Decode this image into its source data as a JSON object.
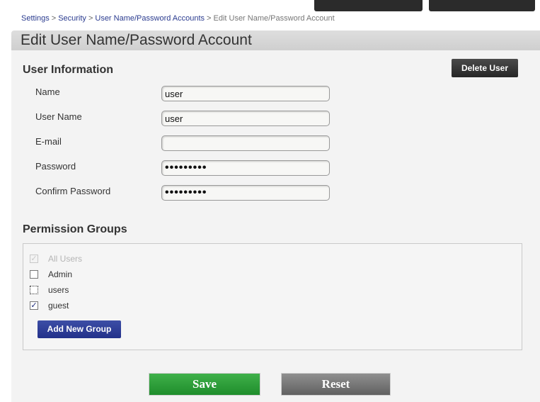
{
  "breadcrumb": {
    "items": [
      "Settings",
      "Security",
      "User Name/Password Accounts"
    ],
    "current": "Edit User Name/Password Account",
    "separator": ">"
  },
  "page_title": "Edit User Name/Password Account",
  "user_info": {
    "heading": "User Information",
    "delete_label": "Delete User",
    "fields": {
      "name": {
        "label": "Name",
        "value": "user"
      },
      "username": {
        "label": "User Name",
        "value": "user"
      },
      "email": {
        "label": "E-mail",
        "value": ""
      },
      "password": {
        "label": "Password",
        "value": "•••••••••"
      },
      "confirm": {
        "label": "Confirm Password",
        "value": "•••••••••"
      }
    }
  },
  "permissions": {
    "heading": "Permission Groups",
    "groups": [
      {
        "label": "All Users",
        "checked": true,
        "disabled": true
      },
      {
        "label": "Admin",
        "checked": false,
        "disabled": false
      },
      {
        "label": "users",
        "checked": false,
        "disabled": false
      },
      {
        "label": "guest",
        "checked": true,
        "disabled": false
      }
    ],
    "add_label": "Add New Group"
  },
  "actions": {
    "save_label": "Save",
    "reset_label": "Reset"
  },
  "colors": {
    "accent_blue": "#23318a",
    "save_green": "#1f8d2c",
    "reset_gray": "#616161",
    "dark_button": "#262626"
  }
}
